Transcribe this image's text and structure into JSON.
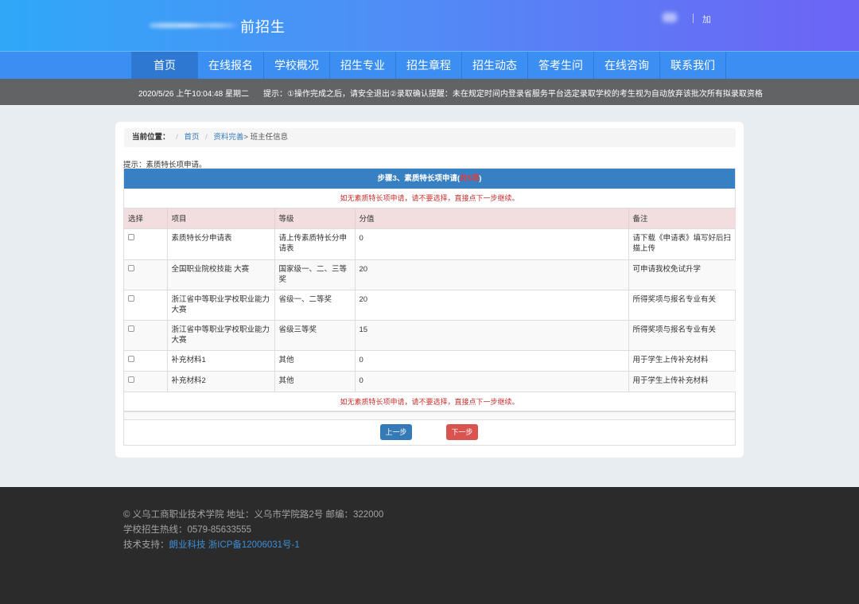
{
  "header": {
    "site_title": "前招生",
    "user_link": "加"
  },
  "nav": {
    "items": [
      {
        "label": "首页",
        "width": 83
      },
      {
        "label": "在线报名",
        "width": 83
      },
      {
        "label": "学校概况",
        "width": 83
      },
      {
        "label": "招生专业",
        "width": 83
      },
      {
        "label": "招生章程",
        "width": 83
      },
      {
        "label": "招生动态",
        "width": 83
      },
      {
        "label": "答考生问",
        "width": 83
      },
      {
        "label": "在线咨询",
        "width": 83
      },
      {
        "label": "联系我们",
        "width": 83
      }
    ]
  },
  "notice": {
    "datetime": "2020/5/26 上午10:04:48 星期二",
    "tip": "提示：①操作完成之后，请安全退出②录取确认提醒：未在规定时间内登录省服务平台选定录取学校的考生视为自动放弃该批次所有拟录取资格"
  },
  "breadcrumb": {
    "label": "当前位置：",
    "home": "首页",
    "section": "资料完善",
    "current": "> 班主任信息"
  },
  "hint": "提示：素质特长项申请。",
  "step": {
    "title": "步骤3、素质特长项申请(",
    "red": "共5项",
    "close": ")"
  },
  "warning": "如无素质特长项申请，请不要选择，直接点下一步继续。",
  "table": {
    "headers": [
      "选择",
      "项目",
      "等级",
      "分值",
      "备注"
    ],
    "rows": [
      {
        "item": "素质特长分申请表",
        "level": "请上传素质特长分申请表",
        "score": "0",
        "note": "请下载《申请表》填写好后扫描上传"
      },
      {
        "item": "全国职业院校技能 大赛",
        "level": "国家级一、二、三等奖",
        "score": "20",
        "note": "可申请我校免试升学"
      },
      {
        "item": "浙江省中等职业学校职业能力大赛",
        "level": "省级一、二等奖",
        "score": "20",
        "note": "所得奖项与报名专业有关"
      },
      {
        "item": "浙江省中等职业学校职业能力大赛",
        "level": "省级三等奖",
        "score": "15",
        "note": "所得奖项与报名专业有关"
      },
      {
        "item": "补充材料1",
        "level": "其他",
        "score": "0",
        "note": "用于学生上传补充材料"
      },
      {
        "item": "补充材料2",
        "level": "其他",
        "score": "0",
        "note": "用于学生上传补充材料"
      }
    ]
  },
  "buttons": {
    "prev": "上一步",
    "next": "下一步"
  },
  "footer": {
    "line1": "© 义乌工商职业技术学院 地址：义乌市学院路2号 邮编：322000",
    "line2": "学校招生热线：0579-85633555",
    "line3_label": "技术支持：",
    "line3_link1": "朗业科技",
    "line3_link2": "浙ICP备12006031号-1"
  }
}
